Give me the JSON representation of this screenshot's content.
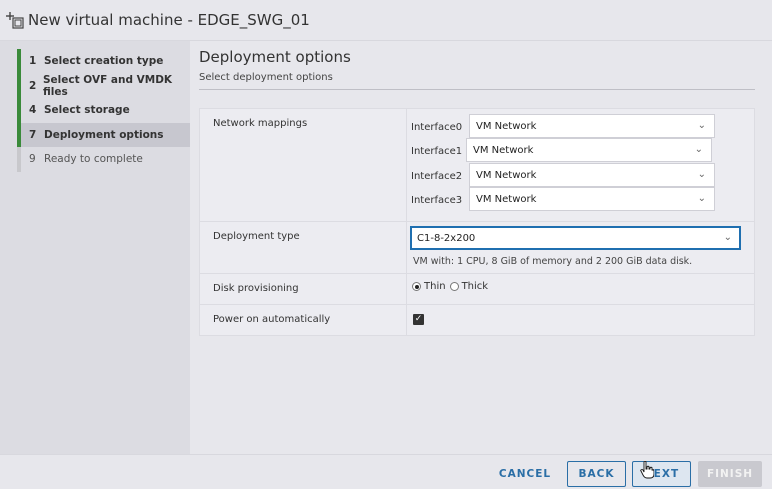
{
  "window": {
    "title": "New virtual machine - EDGE_SWG_01",
    "icon": "new-vm-icon"
  },
  "steps": [
    {
      "num": "1",
      "label": "Select creation type"
    },
    {
      "num": "2",
      "label": "Select OVF and VMDK files"
    },
    {
      "num": "4",
      "label": "Select storage"
    },
    {
      "num": "7",
      "label": "Deployment options"
    },
    {
      "num": "9",
      "label": "Ready to complete"
    }
  ],
  "page": {
    "title": "Deployment options",
    "subtitle": "Select deployment options"
  },
  "network": {
    "label": "Network mappings",
    "interfaces": [
      {
        "name": "Interface0",
        "value": "VM Network"
      },
      {
        "name": "Interface1",
        "value": "VM Network"
      },
      {
        "name": "Interface2",
        "value": "VM Network"
      },
      {
        "name": "Interface3",
        "value": "VM Network"
      }
    ]
  },
  "deployment": {
    "label": "Deployment type",
    "value": "C1-8-2x200",
    "description": "VM with: 1 CPU, 8 GiB of memory and 2 200 GiB data disk."
  },
  "disk": {
    "label": "Disk provisioning",
    "options": [
      "Thin",
      "Thick"
    ],
    "selected": "Thin"
  },
  "power": {
    "label": "Power on automatically",
    "checked": true
  },
  "footer": {
    "cancel": "CANCEL",
    "back": "BACK",
    "next": "NEXT",
    "finish": "FINISH"
  },
  "colors": {
    "accent": "#2a6ea6",
    "step_done": "#3a8a3a",
    "focus": "#1f6fb0"
  }
}
